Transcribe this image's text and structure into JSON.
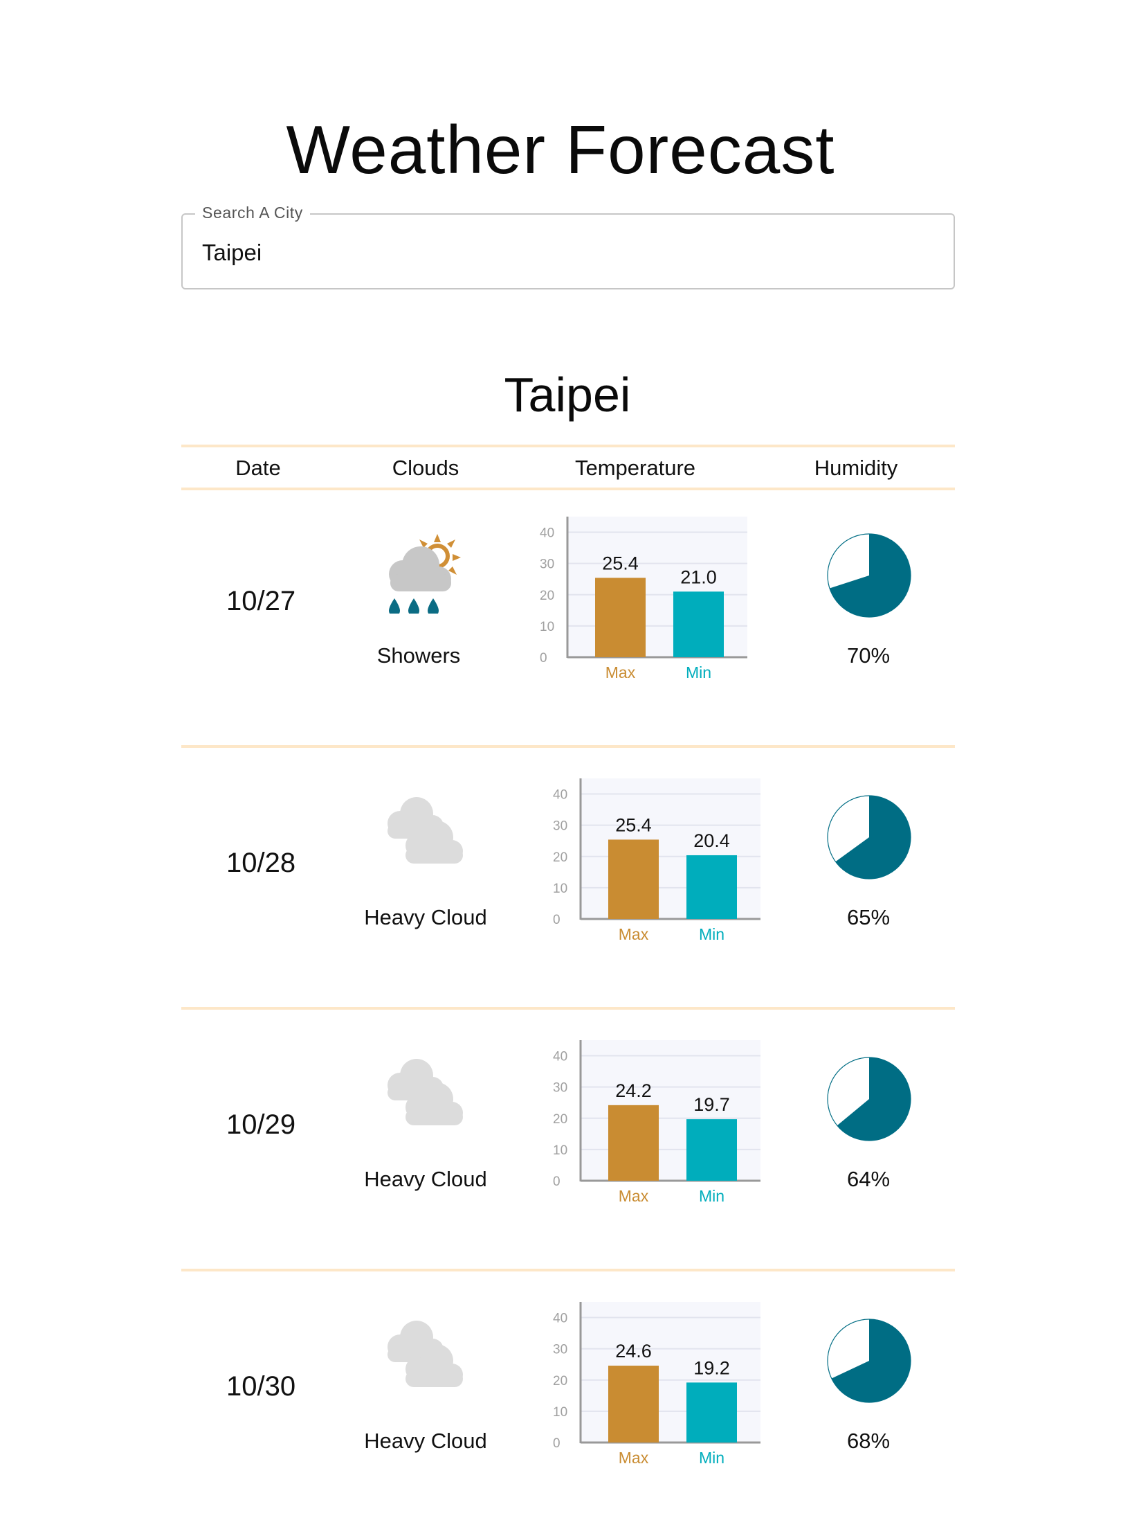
{
  "page": {
    "title": "Weather Forecast",
    "city": "Taipei"
  },
  "search": {
    "label": "Search A City",
    "value": "Taipei"
  },
  "table": {
    "headers": [
      "Date",
      "Clouds",
      "Temperature",
      "Humidity"
    ]
  },
  "colors": {
    "max_bar": "#c98c32",
    "min_bar": "#00adbc",
    "humidity_fill": "#006d84",
    "rule": "#fde7c8",
    "chart_bg": "#f6f7fc"
  },
  "forecast": [
    {
      "date": "10/27",
      "condition": "Showers",
      "icon": "rain-showers-sun-icon",
      "humidity_label": "70%"
    },
    {
      "date": "10/28",
      "condition": "Heavy Cloud",
      "icon": "heavy-cloud-icon",
      "humidity_label": "65%"
    },
    {
      "date": "10/29",
      "condition": "Heavy Cloud",
      "icon": "heavy-cloud-icon",
      "humidity_label": "64%"
    },
    {
      "date": "10/30",
      "condition": "Heavy Cloud",
      "icon": "heavy-cloud-icon",
      "humidity_label": "68%"
    }
  ],
  "chart_data": [
    {
      "type": "bar",
      "categories": [
        "Max",
        "Min"
      ],
      "values": [
        25.4,
        21.0
      ],
      "data_labels": [
        "25.4",
        "21.0"
      ],
      "ylim": [
        0,
        45
      ],
      "yticks": [
        0,
        10,
        20,
        30,
        40
      ],
      "grid": true
    },
    {
      "type": "bar",
      "categories": [
        "Max",
        "Min"
      ],
      "values": [
        25.4,
        20.4
      ],
      "data_labels": [
        "25.4",
        "20.4"
      ],
      "ylim": [
        0,
        45
      ],
      "yticks": [
        0,
        10,
        20,
        30,
        40
      ],
      "grid": true
    },
    {
      "type": "bar",
      "categories": [
        "Max",
        "Min"
      ],
      "values": [
        24.2,
        19.7
      ],
      "data_labels": [
        "24.2",
        "19.7"
      ],
      "ylim": [
        0,
        45
      ],
      "yticks": [
        0,
        10,
        20,
        30,
        40
      ],
      "grid": true
    },
    {
      "type": "bar",
      "categories": [
        "Max",
        "Min"
      ],
      "values": [
        24.6,
        19.2
      ],
      "data_labels": [
        "24.6",
        "19.2"
      ],
      "ylim": [
        0,
        45
      ],
      "yticks": [
        0,
        10,
        20,
        30,
        40
      ],
      "grid": true
    },
    {
      "type": "pie",
      "values": [
        0.7
      ],
      "label": "70%"
    },
    {
      "type": "pie",
      "values": [
        0.65
      ],
      "label": "65%"
    },
    {
      "type": "pie",
      "values": [
        0.64
      ],
      "label": "64%"
    },
    {
      "type": "pie",
      "values": [
        0.68
      ],
      "label": "68%"
    }
  ]
}
